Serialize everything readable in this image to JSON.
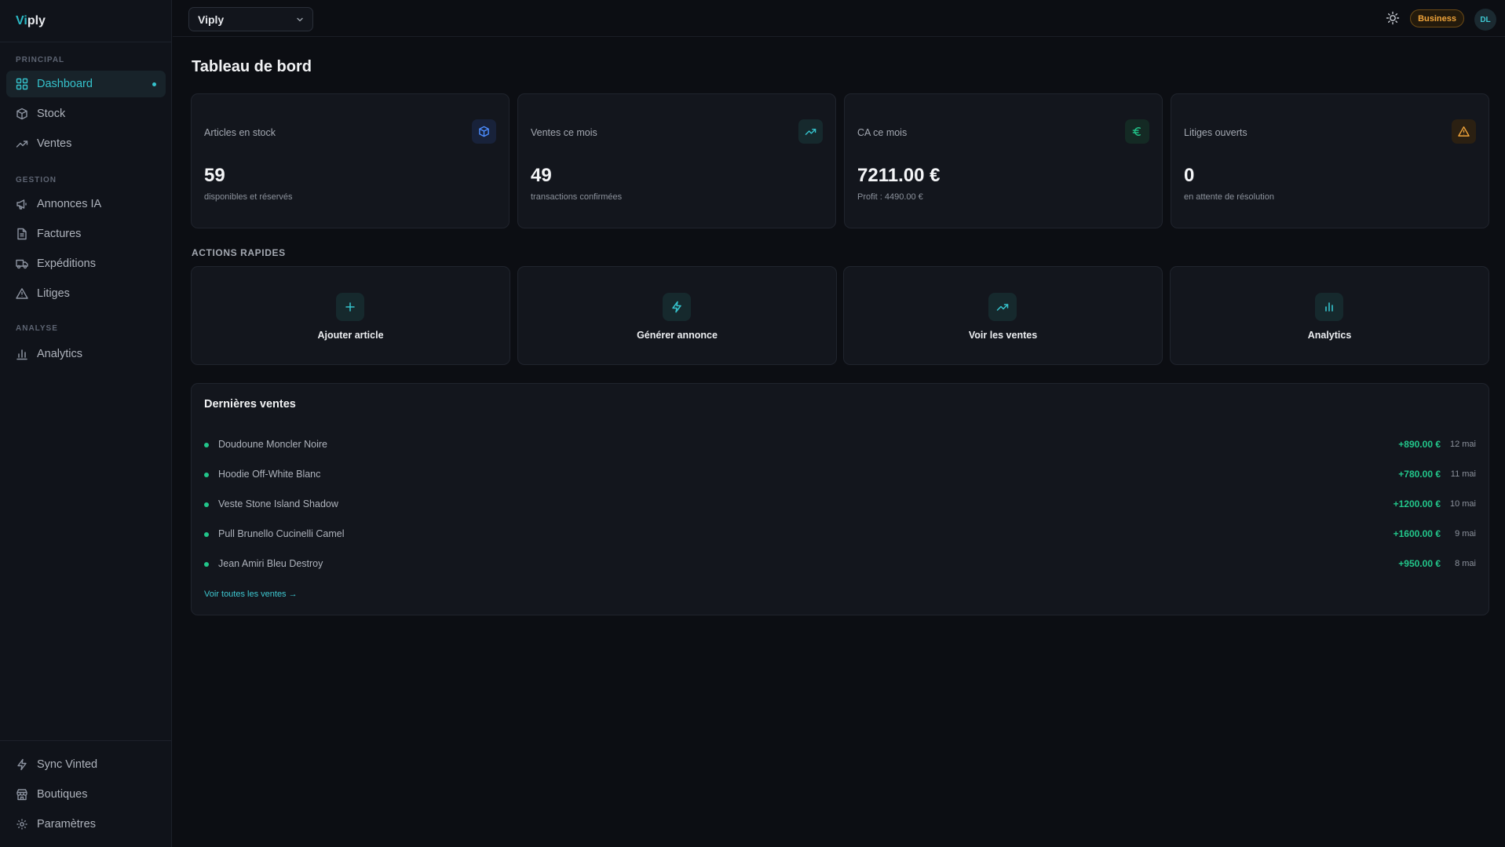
{
  "brand": {
    "prefix": "Vi",
    "suffix": "ply"
  },
  "sidebar": {
    "sections": [
      "PRINCIPAL",
      "GESTION",
      "ANALYSE"
    ],
    "items": [
      {
        "label": "Dashboard",
        "icon": "dashboard-icon"
      },
      {
        "label": "Stock",
        "icon": "box-icon"
      },
      {
        "label": "Ventes",
        "icon": "trending-up-icon"
      },
      {
        "label": "Annonces IA",
        "icon": "megaphone-icon"
      },
      {
        "label": "Factures",
        "icon": "file-icon"
      },
      {
        "label": "Expéditions",
        "icon": "truck-icon"
      },
      {
        "label": "Litiges",
        "icon": "warning-icon"
      },
      {
        "label": "Analytics",
        "icon": "bar-chart-icon"
      }
    ],
    "bottom_items": [
      {
        "label": "Sync Vinted",
        "icon": "bolt-icon"
      },
      {
        "label": "Boutiques",
        "icon": "store-icon"
      },
      {
        "label": "Paramètres",
        "icon": "gear-icon"
      }
    ]
  },
  "topbar": {
    "workspace": "Viply",
    "plan": "Business",
    "avatar_initials": "DL"
  },
  "page": {
    "title": "Tableau de bord"
  },
  "stats": [
    {
      "label": "Articles en stock",
      "value": "59",
      "sub": "disponibles et réservés",
      "icon": "box-icon"
    },
    {
      "label": "Ventes ce mois",
      "value": "49",
      "sub": "transactions confirmées",
      "icon": "trending-up-icon"
    },
    {
      "label": "CA ce mois",
      "value": "7211.00 €",
      "sub": "Profit : 4490.00 €",
      "icon": "euro-icon"
    },
    {
      "label": "Litiges ouverts",
      "value": "0",
      "sub": "en attente de résolution",
      "icon": "warning-icon"
    }
  ],
  "quick_actions": {
    "title": "ACTIONS RAPIDES",
    "items": [
      {
        "label": "Ajouter article",
        "icon": "plus-icon"
      },
      {
        "label": "Générer annonce",
        "icon": "bolt-icon"
      },
      {
        "label": "Voir les ventes",
        "icon": "trending-up-icon"
      },
      {
        "label": "Analytics",
        "icon": "bar-chart-icon"
      }
    ]
  },
  "recent_sales": {
    "title": "Dernières ventes",
    "rows": [
      {
        "name": "Doudoune Moncler Noire",
        "amount": "+890.00 €",
        "date": "12 mai"
      },
      {
        "name": "Hoodie Off-White Blanc",
        "amount": "+780.00 €",
        "date": "11 mai"
      },
      {
        "name": "Veste Stone Island Shadow",
        "amount": "+1200.00 €",
        "date": "10 mai"
      },
      {
        "name": "Pull Brunello Cucinelli Camel",
        "amount": "+1600.00 €",
        "date": "9 mai"
      },
      {
        "name": "Jean Amiri Bleu Destroy",
        "amount": "+950.00 €",
        "date": "8 mai"
      }
    ],
    "see_all": "Voir toutes les ventes →"
  },
  "colors": {
    "accent": "#35c2cc",
    "positive": "#22c58a",
    "warning": "#f0a43a",
    "blue": "#4c8dff"
  }
}
